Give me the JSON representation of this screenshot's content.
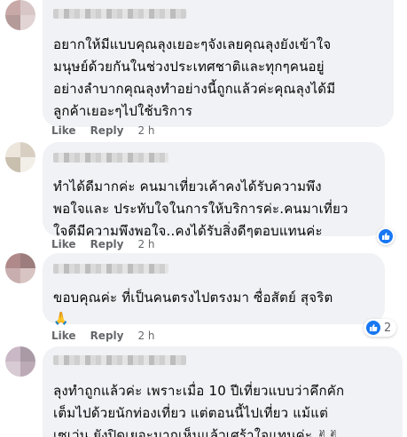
{
  "comments": [
    {
      "text": "อยากให้มีแบบคุณลุงเยอะๆจังเลยคุณลุงยังเข้าใจ\nมนุษย์ด้วยกันในช่วงประเทศชาติและทุกๆคนอยู่\nอย่างลำบากคุณลุงทำอย่างนี้ถูกแล้วค่ะคุณลุงได้มี\nลูกค้าเยอะๆไปใช้บริการ",
      "like_label": "Like",
      "reply_label": "Reply",
      "time": "2 h"
    },
    {
      "text": "ทำได้ดีมากค่ะ คนมาเที่ยวเค้าคงได้รับความพึง\nพอใจและ ประทับใจในการให้บริการค่ะ.คนมาเที่ยว\nใจดีมีความพึงพอใจ..คงได้รับสิ่งดีๆตอบแทนค่ะ",
      "like_label": "Like",
      "reply_label": "Reply",
      "time": "2 h",
      "reaction_count": ""
    },
    {
      "text": "ขอบคุณค่ะ ที่เป็นคนตรงไปตรงมา ซื่อสัตย์ สุจริต",
      "emoji": "🙏",
      "like_label": "Like",
      "reply_label": "Reply",
      "time": "2 h",
      "reaction_count": "2"
    },
    {
      "text": "ลุงทำถูกแล้วค่ะ เพราะเมื่อ 10 ปีเที่ยวแบบว่าคึกคัก\nเต็มไปด้วยนักท่องเที่ยว แต่ตอนนี้ไปเที่ยว แม้แต่\nเซเว่น ยังปิดเยอะมากเห็นแล้วเศร้าใจแทนค่ะ ✌✌"
    }
  ],
  "colors": {
    "bubble": "#f0f2f5",
    "action_text": "#65676b",
    "like_blue": "#1877f2"
  },
  "icons": [
    "blurred-avatar-icon",
    "like-reaction-icon",
    "pray-emoji-icon"
  ]
}
